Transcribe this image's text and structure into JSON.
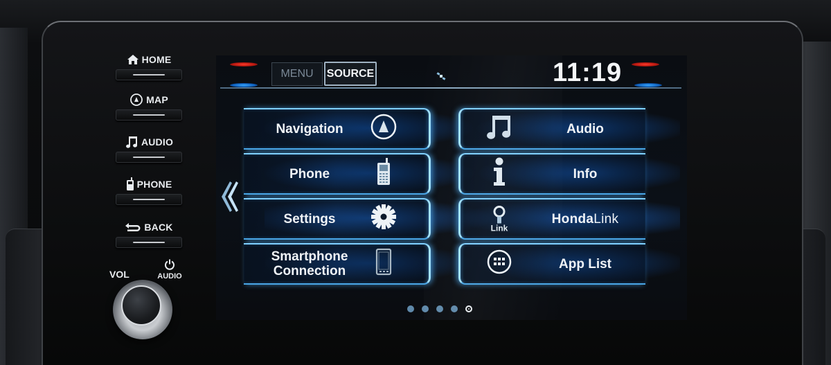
{
  "hard_buttons": [
    {
      "id": "home",
      "label": "HOME",
      "icon": "home-icon"
    },
    {
      "id": "map",
      "label": "MAP",
      "icon": "compass-icon"
    },
    {
      "id": "audio",
      "label": "AUDIO",
      "icon": "music-note-icon"
    },
    {
      "id": "phone",
      "label": "PHONE",
      "icon": "cellphone-icon"
    },
    {
      "id": "back",
      "label": "BACK",
      "icon": "back-arrow-icon"
    }
  ],
  "volume": {
    "label": "VOL",
    "power_label": "AUDIO",
    "power_icon": "power-icon"
  },
  "status_bar": {
    "menu_label": "MENU",
    "source_label": "SOURCE",
    "gps_icon": "satellite-icon",
    "clock": "11:19",
    "colors": {
      "indicator_red": "#ff3a2a",
      "indicator_blue": "#38a8ff"
    }
  },
  "tiles": {
    "left": [
      {
        "label": "Navigation",
        "icon": "navigation-icon"
      },
      {
        "label": "Phone",
        "icon": "cellphone-icon"
      },
      {
        "label": "Settings",
        "icon": "gear-icon"
      },
      {
        "label": "Smartphone Connection",
        "line1": "Smartphone",
        "line2": "Connection",
        "icon": "smartphone-icon"
      }
    ],
    "right": [
      {
        "label": "Audio",
        "icon": "music-note-icon"
      },
      {
        "label": "Info",
        "icon": "info-icon"
      },
      {
        "label_bold": "Honda",
        "label_light": "Link",
        "icon": "hondalink-icon",
        "icon_text": "Link"
      },
      {
        "label": "App List",
        "icon": "app-grid-icon"
      }
    ]
  },
  "pager": {
    "total_pages": 5,
    "current_page": 5
  },
  "prev_page_icon": "double-chevron-left-icon",
  "theme": {
    "tile_glow": "#7fd0ff",
    "tile_bg": "#0a2850",
    "text": "#f0f3f6"
  }
}
